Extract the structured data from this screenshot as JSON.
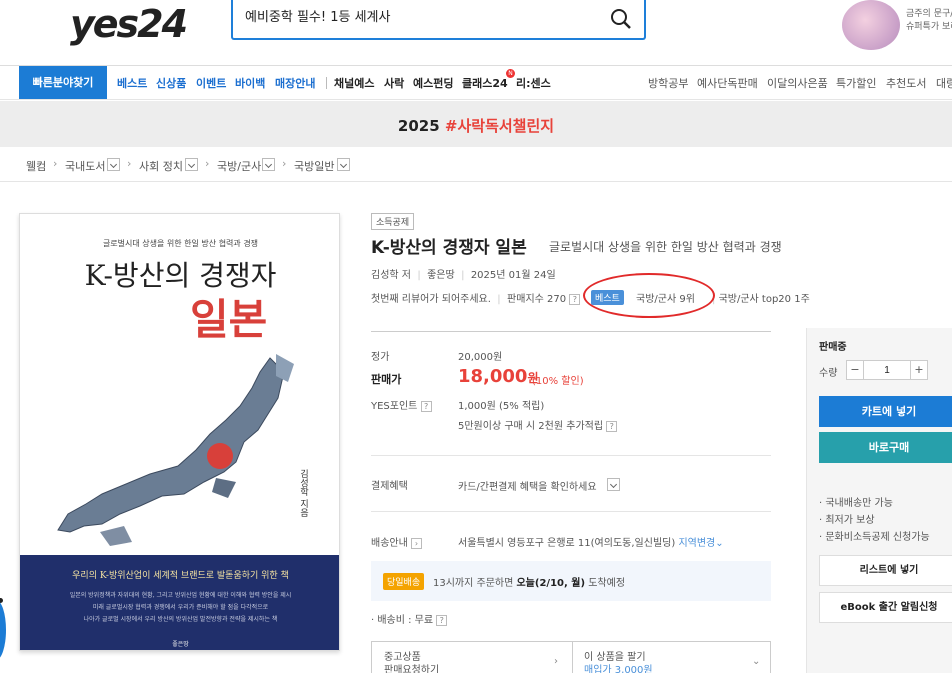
{
  "header": {
    "logo": "yes24",
    "search_value": "예비중학 필수! 1등 세계사",
    "promo_line1": "금주의 문구/",
    "promo_line2": "슈퍼특가 보러"
  },
  "nav": {
    "quick_find": "빠른분야찾기",
    "items_blue": [
      "베스트",
      "신상품",
      "이벤트",
      "바이백",
      "매장안내"
    ],
    "items_dark": [
      "채널예스",
      "사락",
      "예스펀딩",
      "클래스24",
      "리:센스"
    ],
    "badge": "N",
    "items_right": [
      "방학공부",
      "예사단독판매",
      "이달의사은품",
      "특가할인",
      "추천도서",
      "대량"
    ]
  },
  "banner": {
    "year": "2025",
    "highlight": "#사락독서챌린지"
  },
  "breadcrumb": [
    "웰컴",
    "국내도서",
    "사회 정치",
    "국방/군사",
    "국방일반"
  ],
  "cover": {
    "subtitle": "글로벌시대 상생을 위한 한일 방산 협력과 경쟁",
    "title_line1": "K-방산의 경쟁자",
    "title_line2": "일본",
    "author": "김성학 지음",
    "band_title": "우리의 K-방위산업이 세계적 브랜드로 발돋움하기 위한 책",
    "band_lines": [
      "일본의 방위정책과 자위대의 현황, 그리고 방위산업 현황에 대한 이해와 협력 방안을 제시",
      "미래 글로벌시장 협력과 경쟁에서 우리가 준비해야 할 점을 다각적으로",
      "나아가 글로벌 시장에서 우리 방산의 방위산업 발전방향과 전략을 제시하는 책"
    ],
    "publisher": "좋은땅"
  },
  "book": {
    "tag": "소득공제",
    "title": "K-방산의 경쟁자 일본",
    "subtitle": "글로벌시대 상생을 위한 한일 방산 협력과 경쟁",
    "author": "김성학 저",
    "publisher": "좋은땅",
    "date": "2025년 01월 24일",
    "review": "첫번째 리뷰어가 되어주세요.",
    "sales_index": "판매지수 270",
    "best_badge": "베스트",
    "rank1": "국방/군사 9위",
    "rank2": "국방/군사 top20 1주"
  },
  "price": {
    "list_label": "정가",
    "list_value": "20,000원",
    "sale_label": "판매가",
    "sale_value": "18,000",
    "sale_unit": "원",
    "discount": "(10% 할인)",
    "point_label": "YES포인트",
    "point_value": "1,000원 (5% 적립)",
    "point_extra": "5만원이상 구매 시 2천원 추가적립",
    "benefit_label": "결제혜택",
    "benefit_value": "카드/간편결제 혜택을 확인하세요",
    "delivery_label": "배송안내",
    "delivery_address": "서울특별시 영등포구 은행로 11(여의도동,일신빌딩)",
    "region_change": "지역변경",
    "today_badge": "당일배송",
    "today_text_pre": "13시까지 주문하면 ",
    "today_text_bold": "오늘(2/10, 월)",
    "today_text_post": " 도착예정",
    "shipping_fee": "· 배송비 : 무료",
    "used_l1": "중고상품",
    "used_l2": "판매요청하기",
    "sell_l1": "이 상품을 팔기",
    "sell_l2": "매입가 3,000원"
  },
  "panel": {
    "status": "판매중",
    "qty_label": "수량",
    "qty_value": "1",
    "cart": "카트에 넣기",
    "buy": "바로구매",
    "info": [
      "· 국내배송만 가능",
      "· 최저가 보상",
      "· 문화비소득공제 신청가능"
    ],
    "list": "리스트에 넣기",
    "ebook": "eBook 출간 알림신청"
  }
}
